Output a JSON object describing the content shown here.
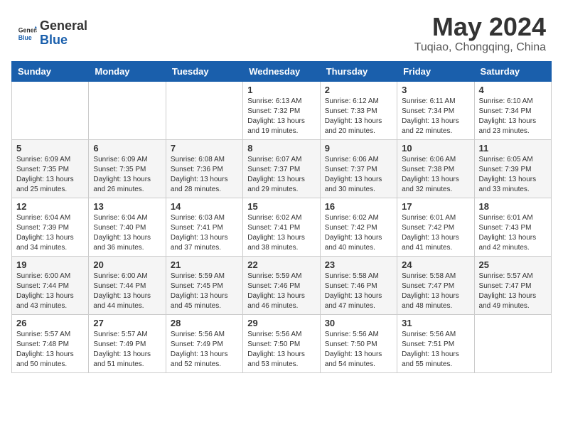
{
  "header": {
    "logo_general": "General",
    "logo_blue": "Blue",
    "month": "May 2024",
    "location": "Tuqiao, Chongqing, China"
  },
  "days_of_week": [
    "Sunday",
    "Monday",
    "Tuesday",
    "Wednesday",
    "Thursday",
    "Friday",
    "Saturday"
  ],
  "weeks": [
    [
      {
        "day": "",
        "info": ""
      },
      {
        "day": "",
        "info": ""
      },
      {
        "day": "",
        "info": ""
      },
      {
        "day": "1",
        "info": "Sunrise: 6:13 AM\nSunset: 7:32 PM\nDaylight: 13 hours\nand 19 minutes."
      },
      {
        "day": "2",
        "info": "Sunrise: 6:12 AM\nSunset: 7:33 PM\nDaylight: 13 hours\nand 20 minutes."
      },
      {
        "day": "3",
        "info": "Sunrise: 6:11 AM\nSunset: 7:34 PM\nDaylight: 13 hours\nand 22 minutes."
      },
      {
        "day": "4",
        "info": "Sunrise: 6:10 AM\nSunset: 7:34 PM\nDaylight: 13 hours\nand 23 minutes."
      }
    ],
    [
      {
        "day": "5",
        "info": "Sunrise: 6:09 AM\nSunset: 7:35 PM\nDaylight: 13 hours\nand 25 minutes."
      },
      {
        "day": "6",
        "info": "Sunrise: 6:09 AM\nSunset: 7:35 PM\nDaylight: 13 hours\nand 26 minutes."
      },
      {
        "day": "7",
        "info": "Sunrise: 6:08 AM\nSunset: 7:36 PM\nDaylight: 13 hours\nand 28 minutes."
      },
      {
        "day": "8",
        "info": "Sunrise: 6:07 AM\nSunset: 7:37 PM\nDaylight: 13 hours\nand 29 minutes."
      },
      {
        "day": "9",
        "info": "Sunrise: 6:06 AM\nSunset: 7:37 PM\nDaylight: 13 hours\nand 30 minutes."
      },
      {
        "day": "10",
        "info": "Sunrise: 6:06 AM\nSunset: 7:38 PM\nDaylight: 13 hours\nand 32 minutes."
      },
      {
        "day": "11",
        "info": "Sunrise: 6:05 AM\nSunset: 7:39 PM\nDaylight: 13 hours\nand 33 minutes."
      }
    ],
    [
      {
        "day": "12",
        "info": "Sunrise: 6:04 AM\nSunset: 7:39 PM\nDaylight: 13 hours\nand 34 minutes."
      },
      {
        "day": "13",
        "info": "Sunrise: 6:04 AM\nSunset: 7:40 PM\nDaylight: 13 hours\nand 36 minutes."
      },
      {
        "day": "14",
        "info": "Sunrise: 6:03 AM\nSunset: 7:41 PM\nDaylight: 13 hours\nand 37 minutes."
      },
      {
        "day": "15",
        "info": "Sunrise: 6:02 AM\nSunset: 7:41 PM\nDaylight: 13 hours\nand 38 minutes."
      },
      {
        "day": "16",
        "info": "Sunrise: 6:02 AM\nSunset: 7:42 PM\nDaylight: 13 hours\nand 40 minutes."
      },
      {
        "day": "17",
        "info": "Sunrise: 6:01 AM\nSunset: 7:42 PM\nDaylight: 13 hours\nand 41 minutes."
      },
      {
        "day": "18",
        "info": "Sunrise: 6:01 AM\nSunset: 7:43 PM\nDaylight: 13 hours\nand 42 minutes."
      }
    ],
    [
      {
        "day": "19",
        "info": "Sunrise: 6:00 AM\nSunset: 7:44 PM\nDaylight: 13 hours\nand 43 minutes."
      },
      {
        "day": "20",
        "info": "Sunrise: 6:00 AM\nSunset: 7:44 PM\nDaylight: 13 hours\nand 44 minutes."
      },
      {
        "day": "21",
        "info": "Sunrise: 5:59 AM\nSunset: 7:45 PM\nDaylight: 13 hours\nand 45 minutes."
      },
      {
        "day": "22",
        "info": "Sunrise: 5:59 AM\nSunset: 7:46 PM\nDaylight: 13 hours\nand 46 minutes."
      },
      {
        "day": "23",
        "info": "Sunrise: 5:58 AM\nSunset: 7:46 PM\nDaylight: 13 hours\nand 47 minutes."
      },
      {
        "day": "24",
        "info": "Sunrise: 5:58 AM\nSunset: 7:47 PM\nDaylight: 13 hours\nand 48 minutes."
      },
      {
        "day": "25",
        "info": "Sunrise: 5:57 AM\nSunset: 7:47 PM\nDaylight: 13 hours\nand 49 minutes."
      }
    ],
    [
      {
        "day": "26",
        "info": "Sunrise: 5:57 AM\nSunset: 7:48 PM\nDaylight: 13 hours\nand 50 minutes."
      },
      {
        "day": "27",
        "info": "Sunrise: 5:57 AM\nSunset: 7:49 PM\nDaylight: 13 hours\nand 51 minutes."
      },
      {
        "day": "28",
        "info": "Sunrise: 5:56 AM\nSunset: 7:49 PM\nDaylight: 13 hours\nand 52 minutes."
      },
      {
        "day": "29",
        "info": "Sunrise: 5:56 AM\nSunset: 7:50 PM\nDaylight: 13 hours\nand 53 minutes."
      },
      {
        "day": "30",
        "info": "Sunrise: 5:56 AM\nSunset: 7:50 PM\nDaylight: 13 hours\nand 54 minutes."
      },
      {
        "day": "31",
        "info": "Sunrise: 5:56 AM\nSunset: 7:51 PM\nDaylight: 13 hours\nand 55 minutes."
      },
      {
        "day": "",
        "info": ""
      }
    ]
  ]
}
